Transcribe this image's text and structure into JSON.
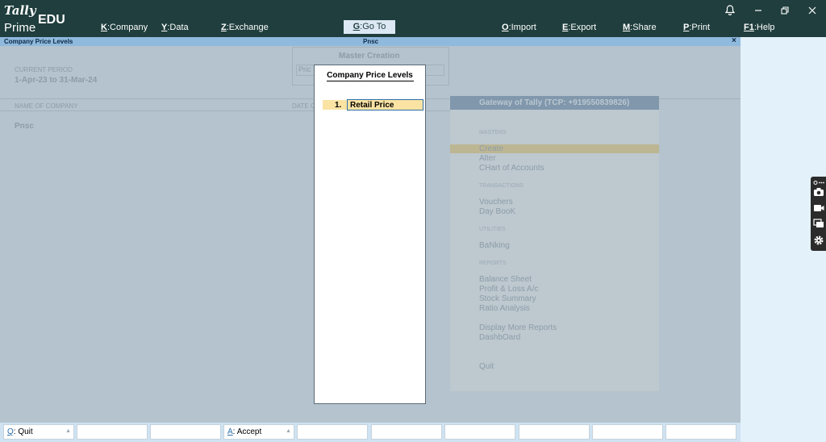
{
  "app": {
    "logo_top": "Tally",
    "logo_edu": "EDU",
    "logo_bottom": "Prime"
  },
  "menu": [
    {
      "key": "K",
      "label": "Company"
    },
    {
      "key": "Y",
      "label": "Data"
    },
    {
      "key": "Z",
      "label": "Exchange"
    },
    {
      "key": "G",
      "label": "Go To"
    },
    {
      "key": "O",
      "label": "Import"
    },
    {
      "key": "E",
      "label": "Export"
    },
    {
      "key": "M",
      "label": "Share"
    },
    {
      "key": "P",
      "label": "Print"
    },
    {
      "key": "F1",
      "label": "Help"
    }
  ],
  "title_strip": {
    "left": "Company Price Levels",
    "center": "Pnsc",
    "close": "×"
  },
  "background": {
    "current_period_label": "CURRENT PERIOD",
    "current_period_value": "1-Apr-23 to 31-Mar-24",
    "name_of_company_label": "NAME OF COMPANY",
    "date_label": "DATE O",
    "company_name": "Pnsc",
    "master_creation_title": "Master Creation",
    "master_creation_field": "Pric",
    "gateway_title": "Gateway of Tally (TCP: +919550839826)",
    "sections": [
      {
        "title": "MASTERS",
        "items": [
          "Create",
          "Alter",
          "CHart of Accounts"
        ]
      },
      {
        "title": "TRANSACTIONS",
        "items": [
          "Vouchers",
          "Day BooK"
        ]
      },
      {
        "title": "UTILITIES",
        "items": [
          "BaNking"
        ]
      },
      {
        "title": "REPORTS",
        "items": [
          "Balance Sheet",
          "Profit & Loss A/c",
          "Stock Summary",
          "Ratio Analysis"
        ]
      },
      {
        "title": "",
        "items": [
          "Display More Reports",
          "DashbOard"
        ]
      },
      {
        "title": "",
        "items": [
          "Quit"
        ]
      }
    ]
  },
  "modal": {
    "title": "Company Price Levels",
    "row_number": "1.",
    "row_value": "Retail Price"
  },
  "fkeys": [
    {
      "key": "Q",
      "label": "Quit"
    },
    {
      "key": "",
      "label": ""
    },
    {
      "key": "",
      "label": ""
    },
    {
      "key": "A",
      "label": "Accept"
    },
    {
      "key": "",
      "label": ""
    },
    {
      "key": "",
      "label": ""
    },
    {
      "key": "",
      "label": ""
    },
    {
      "key": "",
      "label": ""
    },
    {
      "key": "",
      "label": ""
    },
    {
      "key": "",
      "label": ""
    }
  ],
  "icons": {
    "bell": "bell-icon",
    "minimize": "minimize-icon",
    "restore": "restore-icon",
    "close": "close-icon",
    "camera": "camera-icon",
    "video": "video-icon",
    "screens": "screens-icon",
    "settings": "gear-icon"
  }
}
